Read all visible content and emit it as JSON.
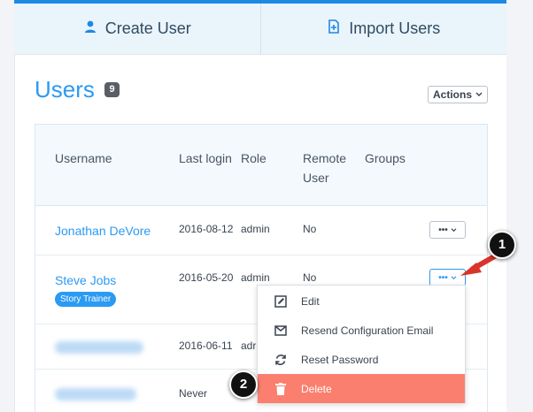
{
  "tabs": {
    "create": "Create User",
    "import": "Import Users"
  },
  "page": {
    "title": "Users",
    "count": "9",
    "actions_label": "Actions"
  },
  "table": {
    "headers": {
      "username": "Username",
      "last_login": "Last login",
      "role": "Role",
      "remote_user": "Remote User",
      "groups": "Groups"
    },
    "rows": [
      {
        "username": "Jonathan DeVore",
        "last_login": "2016-08-12",
        "role": "admin",
        "remote": "No"
      },
      {
        "username": "Steve Jobs",
        "tag": "Story Trainer",
        "last_login": "2016-05-20",
        "role": "admin",
        "remote": "No"
      },
      {
        "last_login": "2016-06-11",
        "role": "adr"
      },
      {
        "last_login": "Never"
      }
    ]
  },
  "row_menu": {
    "dots": "•••",
    "caret": "⌄"
  },
  "dropdown": {
    "items": [
      {
        "label": "Edit",
        "icon": "edit-icon"
      },
      {
        "label": "Resend Configuration Email",
        "icon": "envelope-icon"
      },
      {
        "label": "Reset Password",
        "icon": "refresh-icon"
      },
      {
        "label": "Delete",
        "icon": "trash-icon"
      }
    ]
  },
  "callouts": {
    "one": "1",
    "two": "2"
  },
  "colors": {
    "accent": "#2b9af3",
    "danger": "#fa7f6e",
    "arrow": "#d9342b"
  }
}
